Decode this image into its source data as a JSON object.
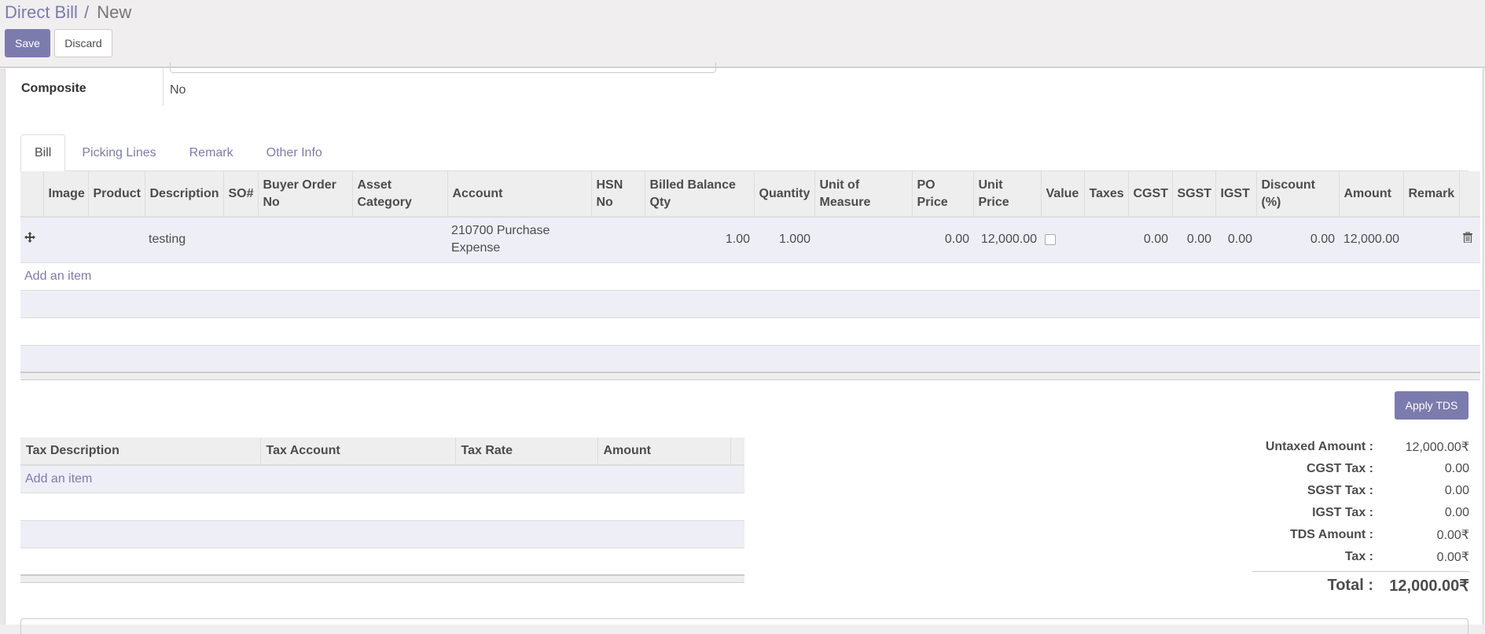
{
  "breadcrumb": {
    "parent": "Direct Bill",
    "separator": "/",
    "current": "New"
  },
  "toolbar": {
    "save_label": "Save",
    "discard_label": "Discard"
  },
  "form": {
    "composite_label": "Composite",
    "composite_value": "No"
  },
  "tabs": [
    {
      "label": "Bill",
      "active": true
    },
    {
      "label": "Picking Lines",
      "active": false
    },
    {
      "label": "Remark",
      "active": false
    },
    {
      "label": "Other Info",
      "active": false
    }
  ],
  "lines_table": {
    "columns": [
      "",
      "Image",
      "Product",
      "Description",
      "SO#",
      "Buyer Order No",
      "Asset Category",
      "Account",
      "HSN No",
      "Billed Balance Qty",
      "Quantity",
      "Unit of Measure",
      "PO Price",
      "Unit Price",
      "Value",
      "Taxes",
      "CGST",
      "SGST",
      "IGST",
      "Discount (%)",
      "Amount",
      "Remark",
      ""
    ],
    "rows": [
      {
        "image": "",
        "product": "",
        "description": "testing",
        "so": "",
        "buyer_order_no": "",
        "asset_category": "",
        "account": "210700 Purchase Expense",
        "hsn_no": "",
        "billed_balance_qty": "1.00",
        "quantity": "1.000",
        "uom": "",
        "po_price": "0.00",
        "unit_price": "12,000.00",
        "value_checked": false,
        "taxes": "",
        "cgst": "0.00",
        "sgst": "0.00",
        "igst": "0.00",
        "discount": "0.00",
        "amount": "12,000.00",
        "remark": ""
      }
    ],
    "add_item_label": "Add an item",
    "row_icons": {
      "drag": "drag-handle-icon",
      "delete": "trash-icon"
    }
  },
  "apply_tds_label": "Apply TDS",
  "tax_table": {
    "columns": [
      "Tax Description",
      "Tax Account",
      "Tax Rate",
      "Amount"
    ],
    "add_item_label": "Add an item"
  },
  "totals": {
    "untaxed_label": "Untaxed Amount :",
    "untaxed_value": "12,000.00₹",
    "cgst_label": "CGST Tax :",
    "cgst_value": "0.00",
    "sgst_label": "SGST Tax :",
    "sgst_value": "0.00",
    "igst_label": "IGST Tax :",
    "igst_value": "0.00",
    "tds_label": "TDS Amount :",
    "tds_value": "0.00₹",
    "tax_label": "Tax :",
    "tax_value": "0.00₹",
    "total_label": "Total :",
    "total_value": "12,000.00₹"
  },
  "colors": {
    "primary": "#7c7bad",
    "row_highlight": "#eeeef6",
    "header_bg": "#eeeeee"
  }
}
